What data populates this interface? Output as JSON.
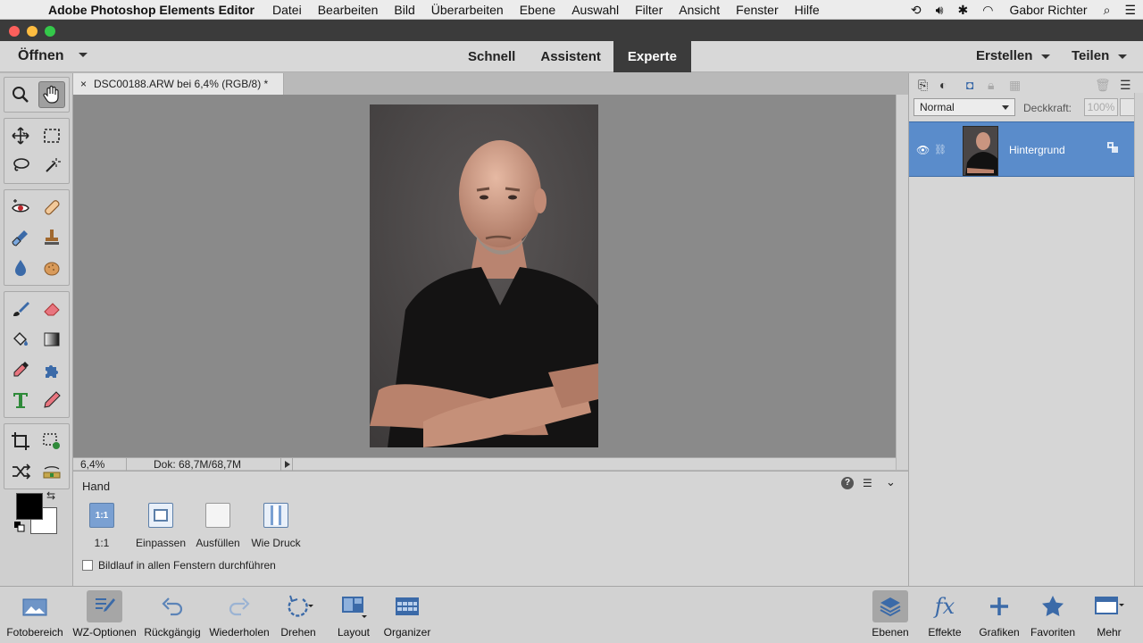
{
  "menubar": {
    "app_name": "Adobe Photoshop Elements Editor",
    "items": [
      "Datei",
      "Bearbeiten",
      "Bild",
      "Überarbeiten",
      "Ebene",
      "Auswahl",
      "Filter",
      "Ansicht",
      "Fenster",
      "Hilfe"
    ],
    "user": "Gabor Richter"
  },
  "appbar": {
    "open_label": "Öffnen",
    "modes": [
      "Schnell",
      "Assistent",
      "Experte"
    ],
    "active_mode": "Experte",
    "create_label": "Erstellen",
    "share_label": "Teilen"
  },
  "document": {
    "tab_title": "DSC00188.ARW bei 6,4% (RGB/8) *",
    "zoom": "6,4%",
    "doc_size": "Dok: 68,7M/68,7M"
  },
  "tool_options": {
    "tool_name": "Hand",
    "buttons": [
      "1:1",
      "Einpassen",
      "Ausfüllen",
      "Wie Druck"
    ],
    "one_to_one_icon_text": "1:1",
    "scroll_all_label": "Bildlauf in allen Fenstern durchführen"
  },
  "layers": {
    "blend_mode": "Normal",
    "opacity_label": "Deckkraft:",
    "opacity_value": "100%",
    "layer_name": "Hintergrund"
  },
  "dock": {
    "left": [
      "Fotobereich",
      "WZ-Optionen",
      "Rückgängig",
      "Wiederholen",
      "Drehen",
      "Layout",
      "Organizer"
    ],
    "right": [
      "Ebenen",
      "Effekte",
      "Grafiken",
      "Favoriten",
      "Mehr"
    ],
    "effects_icon_text": "fx"
  },
  "colors": {
    "accent_blue": "#5a8ccb",
    "dark_mode_bg": "#3b3b3b",
    "foreground_color": "#000000",
    "background_color": "#ffffff"
  }
}
